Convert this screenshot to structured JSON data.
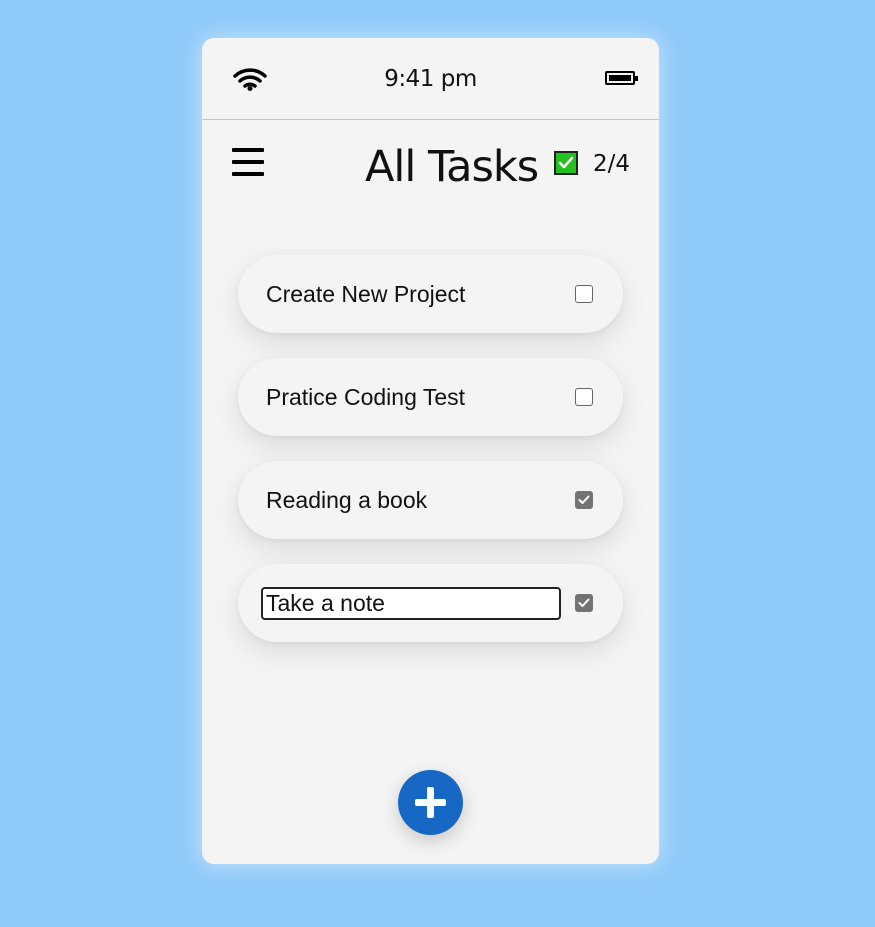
{
  "status_bar": {
    "time": "9:41 pm",
    "wifi_icon": "wifi-icon",
    "battery_icon": "battery-icon"
  },
  "header": {
    "menu_icon": "hamburger-menu-icon",
    "title": "All Tasks",
    "completed_count": "2/4",
    "count_icon_color": "#22c21e"
  },
  "tasks": [
    {
      "label": "Create New Project",
      "checked": false
    },
    {
      "label": "Pratice Coding Test",
      "checked": false
    },
    {
      "label": "Reading a book",
      "checked": true
    },
    {
      "label": "Take a note",
      "checked": true,
      "editing": true
    }
  ],
  "fab": {
    "icon": "plus-icon",
    "color": "#1668c4"
  },
  "colors": {
    "background": "#90caf9",
    "card": "#f4f4f4",
    "checked_box": "#737373"
  }
}
